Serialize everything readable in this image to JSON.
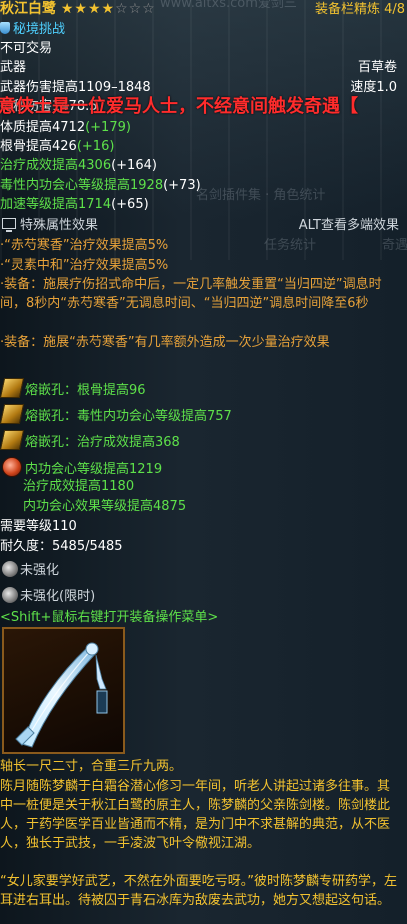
{
  "header": {
    "item_name": "秋江白鹭",
    "stars_filled": 4,
    "stars_empty": 3,
    "watermark_url": "www.aitxs.com爱剑三",
    "refine_label": "装备栏精炼 4/8",
    "challenge": "秘境挑战"
  },
  "basic": {
    "untradeable": "不可交易",
    "type": "武器",
    "category": "百草卷",
    "damage": "武器伤害提高1109–1848",
    "speed": "速度1.0",
    "dps": "每秒伤害1478.5"
  },
  "banner": "意侠士是一位爱马人士，不经意间触发奇遇【",
  "stats": {
    "s1": "体质提高4712",
    "s1b": "(+179)",
    "s2": "根骨提高426",
    "s2b": "(+16)",
    "s3": "治疗成效提高4306",
    "s3b": "(+164)",
    "s4": "毒性内功会心等级提高1928",
    "s4b": "(+73)",
    "s5": "加速等级提高1714",
    "s5b": "(+65)"
  },
  "watermarks": {
    "w1": "名剑插件集 · 角色统计",
    "w2": "任务统计",
    "w3": "奇遇"
  },
  "special": {
    "heading": "特殊属性效果",
    "alt_hint": "ALT查看多端效果",
    "e1": "·“赤芍寒香”治疗效果提高5%",
    "e2": "·“灵素中和”治疗效果提高5%",
    "e3": "·装备：施展疗伤招式命中后，一定几率触发重置“当归四逆”调息时间，8秒内“赤芍寒香”无调息时间、“当归四逆”调息时间降至6秒",
    "e4": "·装备：施展“赤芍寒香”有几率额外造成一次少量治疗效果"
  },
  "sockets": {
    "g1": "熔嵌孔：根骨提高96",
    "g2": "熔嵌孔：毒性内功会心等级提高757",
    "g3": "熔嵌孔：治疗成效提高368",
    "stone": "内功会心等级提高1219",
    "stone2": "治疗成效提高1180",
    "stone3": "内功会心效果等级提高4875"
  },
  "requirements": {
    "level": "需要等级110",
    "durability": "耐久度：5485/5485",
    "enhance1": "未强化",
    "enhance2": "未强化(限时)",
    "menu_hint": "<Shift+鼠标右键打开装备操作菜单>"
  },
  "lore": {
    "l1": "轴长一尺二寸，合重三斤九两。",
    "l2": "陈月随陈梦麟于白霜谷潜心修习一年间，听老人讲起过诸多往事。其中一桩便是关于秋江白鹭的原主人，陈梦麟的父亲陈剑楼。陈剑楼此人，于药学医学百业皆通而不精，是为门中不求甚解的典范，从不医人，独长于武技，一手凌波飞叶令儆视江湖。",
    "l3": "“女儿家要学好武艺，不然在外面要吃亏呀。”彼时陈梦麟专研药学，左耳进右耳出。待被囚于青石冰库为敌废去武功，她方又想起这句话。"
  },
  "colors": {
    "gold": "#f2c230",
    "green": "#5ee14a",
    "orange": "#e7a23a",
    "cyan": "#4fd0ff",
    "red": "#ff2c2c"
  }
}
